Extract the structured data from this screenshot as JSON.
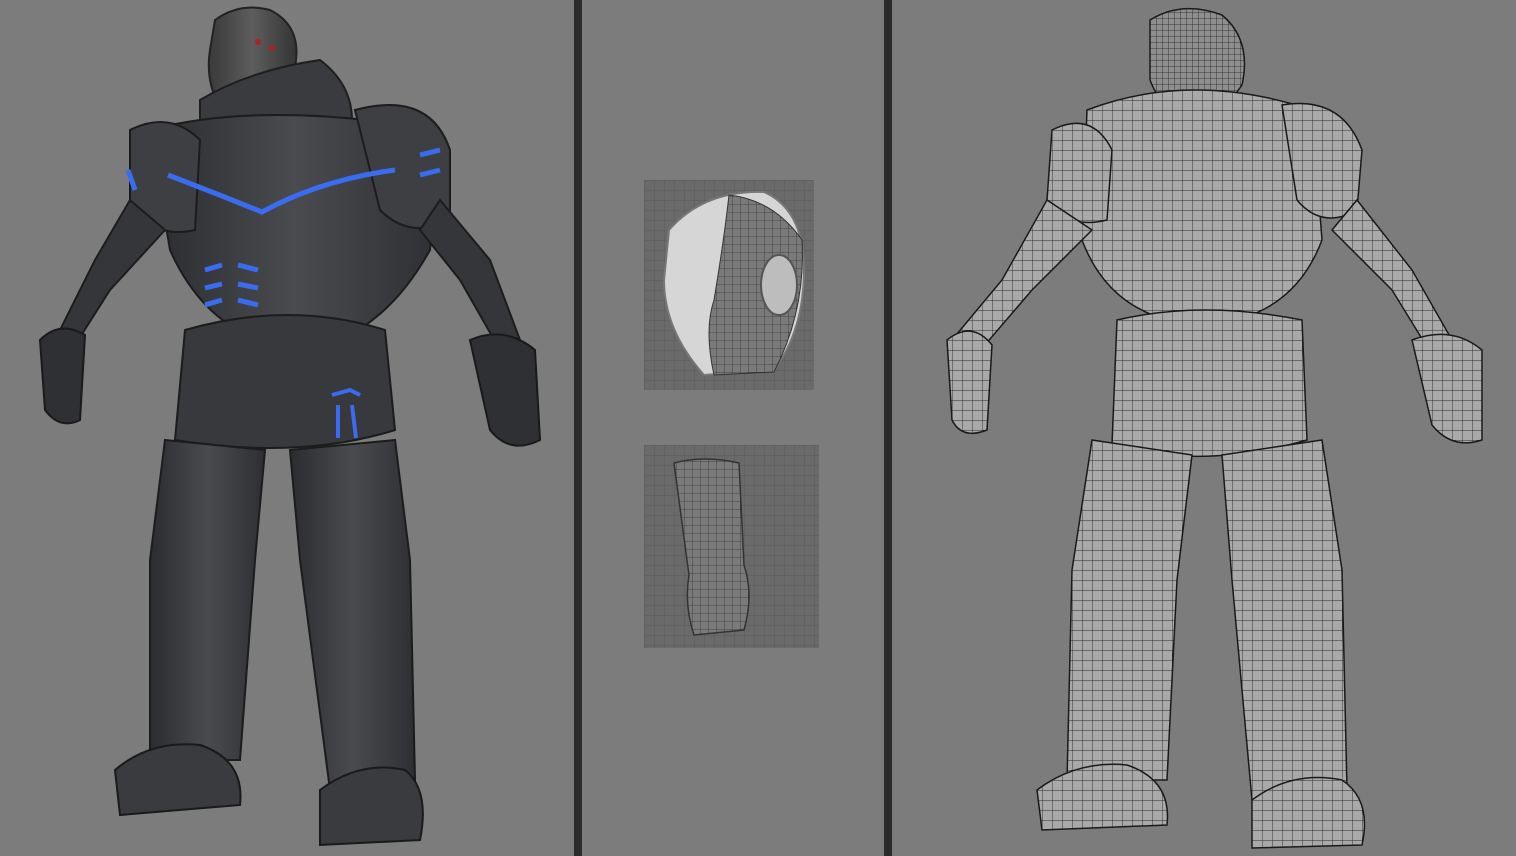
{
  "viewports": {
    "left": {
      "view": "shaded-sculpt",
      "accent_color": "#3a6cf0"
    },
    "middle": {
      "items": [
        "helmet-uv-preview",
        "boot-uv-preview"
      ]
    },
    "right": {
      "view": "wireframe-topology"
    }
  },
  "colors": {
    "background": "#7c7c7c",
    "divider": "#2b2b2b",
    "armor": "#3c3d40",
    "glow": "#3a6cf0",
    "wire": "#2a2a2a",
    "wire_fill": "#a8a8a8"
  }
}
